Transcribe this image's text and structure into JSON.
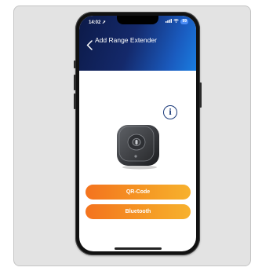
{
  "status_bar": {
    "time": "14:02",
    "battery": "99"
  },
  "header": {
    "back_icon": "chevron-left-icon",
    "title": "Add Range Extender"
  },
  "info_button": {
    "glyph": "i"
  },
  "buttons": {
    "qr_code": "QR-Code",
    "bluetooth": "Bluetooth"
  },
  "colors": {
    "header_start": "#0c1a48",
    "header_end": "#1a7de0",
    "button_start": "#f4731e",
    "button_end": "#f7b12e"
  }
}
